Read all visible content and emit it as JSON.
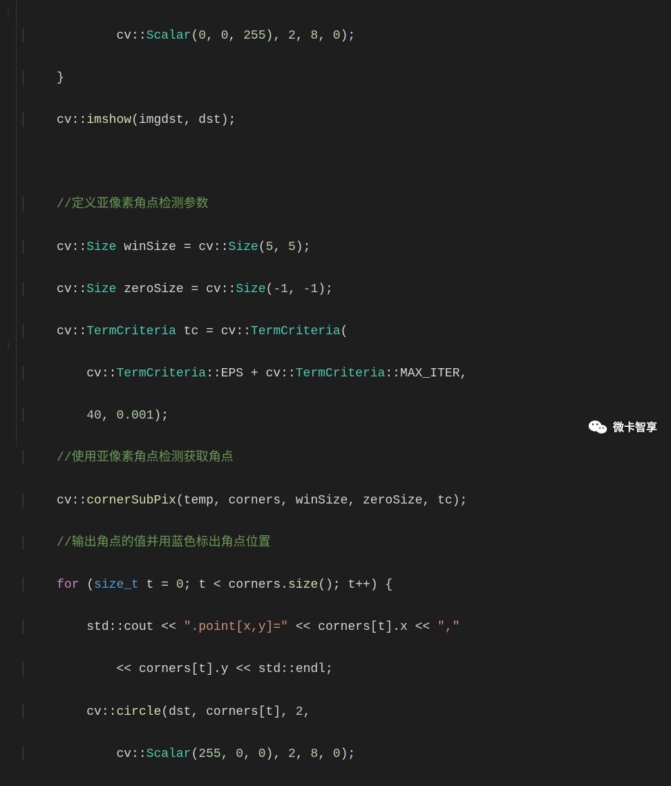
{
  "code": {
    "indent3": "            ",
    "indent2": "        ",
    "indent1": "    ",
    "l1": {
      "ns": "cv",
      "type": "Scalar",
      "args_open": "(",
      "n1": "0",
      "c1": ", ",
      "n2": "0",
      "c2": ", ",
      "n3": "255",
      "args_close": ")",
      "c3": ", ",
      "n4": "2",
      "c4": ", ",
      "n5": "8",
      "c5": ", ",
      "n6": "0",
      "end": ");"
    },
    "l2": {
      "brace": "}"
    },
    "l3": {
      "ns": "cv",
      "fn": "imshow",
      "open": "(",
      "a1": "imgdst",
      "c1": ", ",
      "a2": "dst",
      "close": ");"
    },
    "l5": {
      "comment": "//定义亚像素角点检测参数"
    },
    "l6": {
      "ns1": "cv",
      "type1": "Size",
      "var": "winSize",
      "eq": " = ",
      "ns2": "cv",
      "type2": "Size",
      "open": "(",
      "n1": "5",
      "c1": ", ",
      "n2": "5",
      "close": ");"
    },
    "l7": {
      "ns1": "cv",
      "type1": "Size",
      "var": "zeroSize",
      "eq": " = ",
      "ns2": "cv",
      "type2": "Size",
      "open": "(",
      "n1": "-1",
      "c1": ", ",
      "n2": "-1",
      "close": ");"
    },
    "l8": {
      "ns1": "cv",
      "type1": "TermCriteria",
      "var": "tc",
      "eq": " = ",
      "ns2": "cv",
      "type2": "TermCriteria",
      "open": "("
    },
    "l9": {
      "ns1": "cv",
      "type1": "TermCriteria",
      "const1": "EPS",
      "plus": " + ",
      "ns2": "cv",
      "type2": "TermCriteria",
      "const2": "MAX_ITER",
      "comma": ","
    },
    "l10": {
      "n1": "40",
      "c1": ", ",
      "n2": "0.001",
      "close": ");"
    },
    "l11": {
      "comment": "//使用亚像素角点检测获取角点"
    },
    "l12": {
      "ns": "cv",
      "fn": "cornerSubPix",
      "open": "(",
      "a1": "temp",
      "c1": ", ",
      "a2": "corners",
      "c2": ", ",
      "a3": "winSize",
      "c3": ", ",
      "a4": "zeroSize",
      "c4": ", ",
      "a5": "tc",
      "close": ");"
    },
    "l13": {
      "comment": "//输出角点的值并用蓝色标出角点位置"
    },
    "l14": {
      "for": "for",
      "open": " (",
      "type": "size_t",
      "var": "t",
      "eq": " = ",
      "n0": "0",
      "semi1": "; ",
      "var2": "t",
      "lt": " < ",
      "obj": "corners",
      "dot": ".",
      "fn": "size",
      "call": "()",
      "semi2": "; ",
      "var3": "t",
      "inc": "++",
      "close": ") {"
    },
    "l15": {
      "ns": "std",
      "obj": "cout",
      "op1": " << ",
      "str1": "\".point[x,y]=\"",
      "op2": " << ",
      "obj2": "corners",
      "idx_open": "[",
      "idx": "t",
      "idx_close": "]",
      "dot": ".",
      "mem": "x",
      "op3": " << ",
      "str2": "\",\""
    },
    "l16": {
      "op1": "<< ",
      "obj": "corners",
      "idx_open": "[",
      "idx": "t",
      "idx_close": "]",
      "dot": ".",
      "mem": "y",
      "op2": " << ",
      "ns": "std",
      "endl": "endl",
      "semi": ";"
    },
    "l17": {
      "ns": "cv",
      "fn": "circle",
      "open": "(",
      "a1": "dst",
      "c1": ", ",
      "a2": "corners",
      "idx_open": "[",
      "idx": "t",
      "idx_close": "]",
      "c2": ", ",
      "n1": "2",
      "comma": ","
    },
    "l18": {
      "ns": "cv",
      "type": "Scalar",
      "open": "(",
      "n1": "255",
      "c1": ", ",
      "n2": "0",
      "c2": ", ",
      "n3": "0",
      "close": ")",
      "c3": ", ",
      "n4": "2",
      "c4": ", ",
      "n5": "8",
      "c5": ", ",
      "n6": "0",
      "end": ");"
    }
  },
  "watermark": {
    "text": "微卡智享"
  }
}
